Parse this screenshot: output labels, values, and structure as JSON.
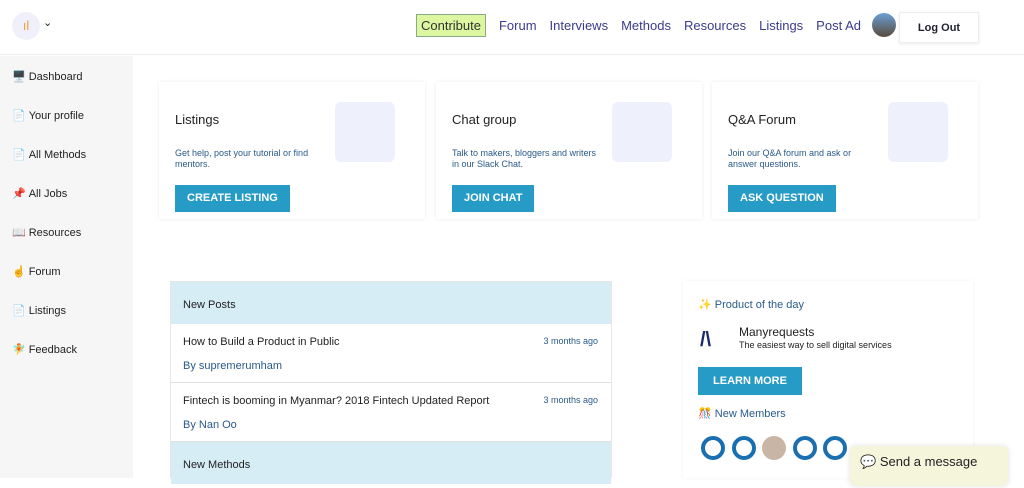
{
  "header": {
    "nav": [
      "Contribute",
      "Forum",
      "Interviews",
      "Methods",
      "Resources",
      "Listings",
      "Post Ad"
    ],
    "logout": "Log Out"
  },
  "sidebar": [
    {
      "icon": "🖥️",
      "label": "Dashboard"
    },
    {
      "icon": "📄",
      "label": "Your profile"
    },
    {
      "icon": "📄",
      "label": "All Methods"
    },
    {
      "icon": "📌",
      "label": "All Jobs"
    },
    {
      "icon": "📖",
      "label": "Resources"
    },
    {
      "icon": "☝️",
      "label": "Forum"
    },
    {
      "icon": "📄",
      "label": "Listings"
    },
    {
      "icon": "🧚",
      "label": "Feedback"
    }
  ],
  "cards": [
    {
      "title": "Listings",
      "desc": "Get help, post your tutorial or find mentors.",
      "button": "CREATE LISTING"
    },
    {
      "title": "Chat group",
      "desc": "Talk to makers, bloggers and writers in our Slack Chat.",
      "button": "JOIN CHAT"
    },
    {
      "title": "Q&A Forum",
      "desc": "Join our Q&A forum and ask or answer questions.",
      "button": "ASK QUESTION"
    }
  ],
  "posts": {
    "header": "New Posts",
    "items": [
      {
        "title": "How to Build a Product in Public",
        "author": "By supremerumham",
        "date": "3 months ago"
      },
      {
        "title": "Fintech is booming in Myanmar? 2018 Fintech Updated Report",
        "author": "By Nan Oo",
        "date": "3 months ago"
      }
    ],
    "methods_header": "New Methods"
  },
  "product": {
    "heading": "✨ Product of the day",
    "name": "Manyrequests",
    "tagline": "The easiest way to sell digital services",
    "button": "LEARN MORE",
    "members_heading": "🎊 New Members"
  },
  "chat": "Send a message"
}
